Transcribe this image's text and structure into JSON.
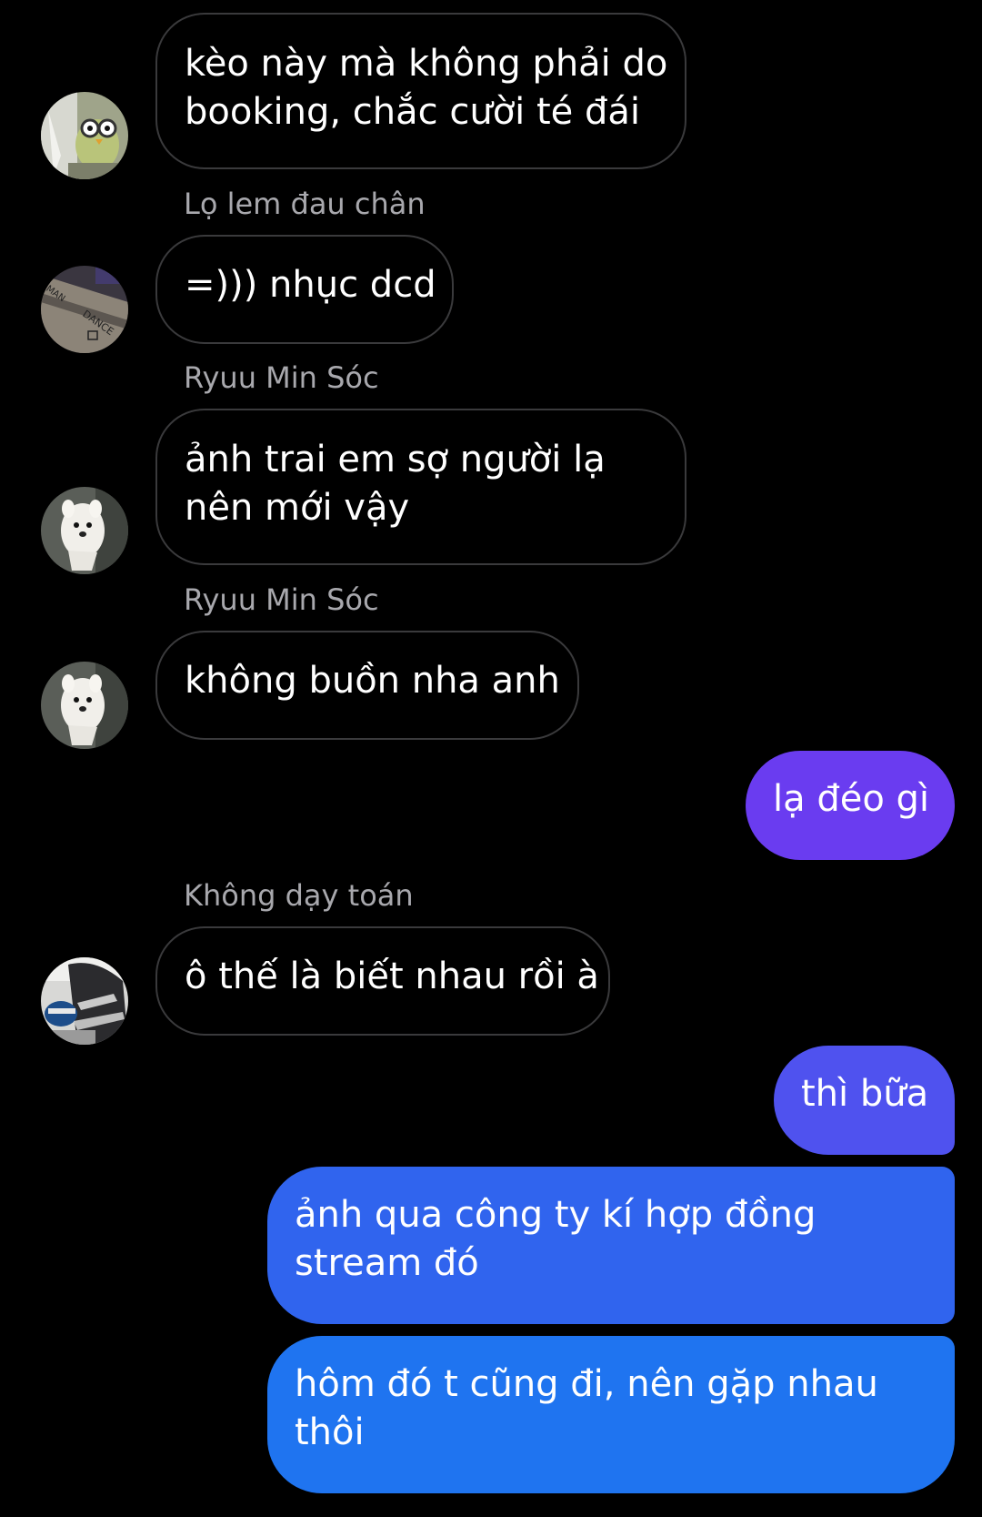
{
  "colors": {
    "background": "#000000",
    "incoming_border": "#3a3a3c",
    "sender_name": "#a8a8ad",
    "outgoing_purple": "#6a3cf0",
    "outgoing_indigo": "#4f52ef",
    "outgoing_blue": "#3064ee",
    "outgoing_blue_bottom": "#1f74f0"
  },
  "messages": [
    {
      "sender": "",
      "lines": [
        "kèo này mà không phải do",
        "booking, chắc cười té đái"
      ],
      "avatar_icon": "bird-avatar-icon"
    },
    {
      "sender": "Lọ lem đau chân",
      "lines": [
        "=))) nhục dcd"
      ],
      "avatar_icon": "dance-card-avatar-icon"
    },
    {
      "sender": "Ryuu Min Sóc",
      "lines": [
        "ảnh trai em sợ người lạ",
        "nên mới vậy"
      ],
      "avatar_icon": "white-dog-avatar-icon"
    },
    {
      "sender": "Ryuu Min Sóc",
      "lines": [
        "không buồn nha anh"
      ],
      "avatar_icon": "white-dog-avatar-icon"
    },
    {
      "sender": "",
      "lines": [
        "lạ đéo gì"
      ],
      "outgoing": true
    },
    {
      "sender": "Không dạy toán",
      "lines": [
        "ô thế là biết nhau rồi à"
      ],
      "avatar_icon": "dj-avatar-icon"
    },
    {
      "sender": "",
      "lines": [
        "thì bữa"
      ],
      "outgoing": true
    },
    {
      "sender": "",
      "lines": [
        "ảnh qua công ty kí hợp đồng",
        "stream đó"
      ],
      "outgoing": true
    },
    {
      "sender": "",
      "lines": [
        "hôm đó t cũng đi, nên gặp nhau",
        "thôi"
      ],
      "outgoing": true
    }
  ]
}
